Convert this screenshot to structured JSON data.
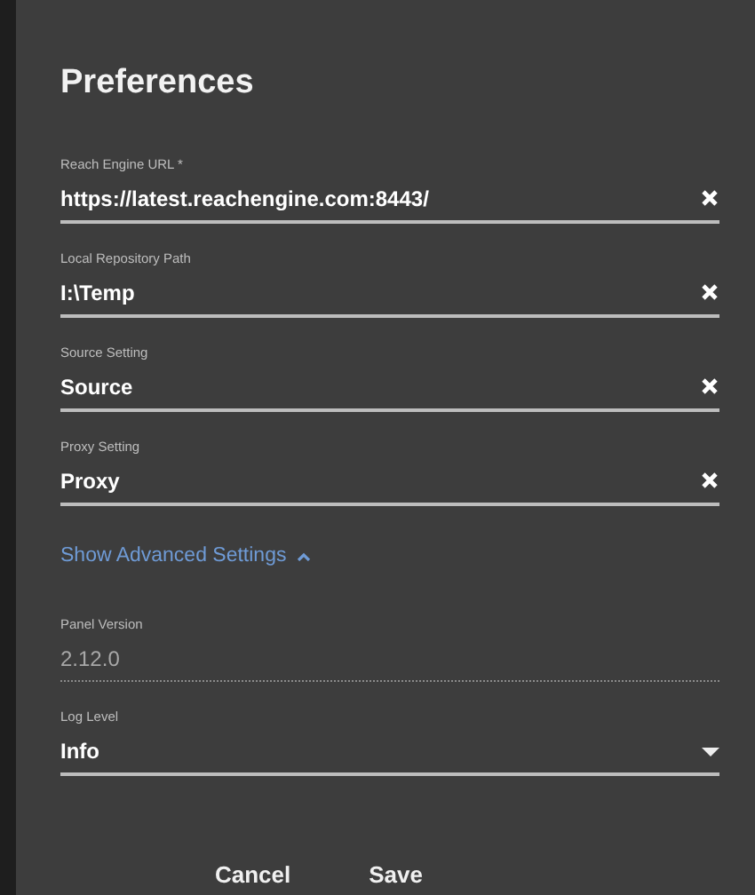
{
  "dialog": {
    "title": "Preferences"
  },
  "fields": [
    {
      "kind": "text",
      "label": "Reach Engine URL *",
      "value": "https://latest.reachengine.com:8443/"
    },
    {
      "kind": "text",
      "label": "Local Repository Path",
      "value": "I:\\Temp"
    },
    {
      "kind": "text",
      "label": "Source Setting",
      "value": "Source"
    },
    {
      "kind": "text",
      "label": "Proxy Setting",
      "value": "Proxy"
    }
  ],
  "advanced_toggle": {
    "label": "Show Advanced Settings",
    "expanded": true
  },
  "advanced_fields": [
    {
      "kind": "readonly",
      "label": "Panel Version",
      "value": "2.12.0"
    },
    {
      "kind": "select",
      "label": "Log Level",
      "value": "Info"
    }
  ],
  "buttons": [
    "Cancel",
    "Save"
  ]
}
